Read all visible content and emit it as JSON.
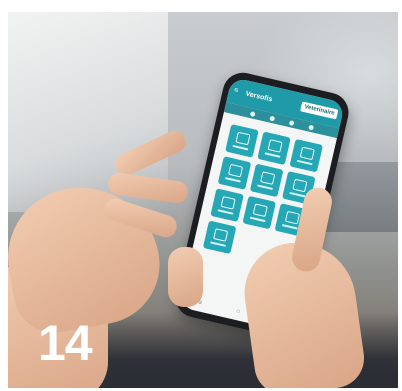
{
  "photo": {
    "number": "14"
  },
  "app": {
    "logo": "Versofis",
    "institution_title": "Veterinaire",
    "institution_subtitle": "",
    "menu_icon": "hamburger-icon",
    "tile_count_visible": 10
  }
}
